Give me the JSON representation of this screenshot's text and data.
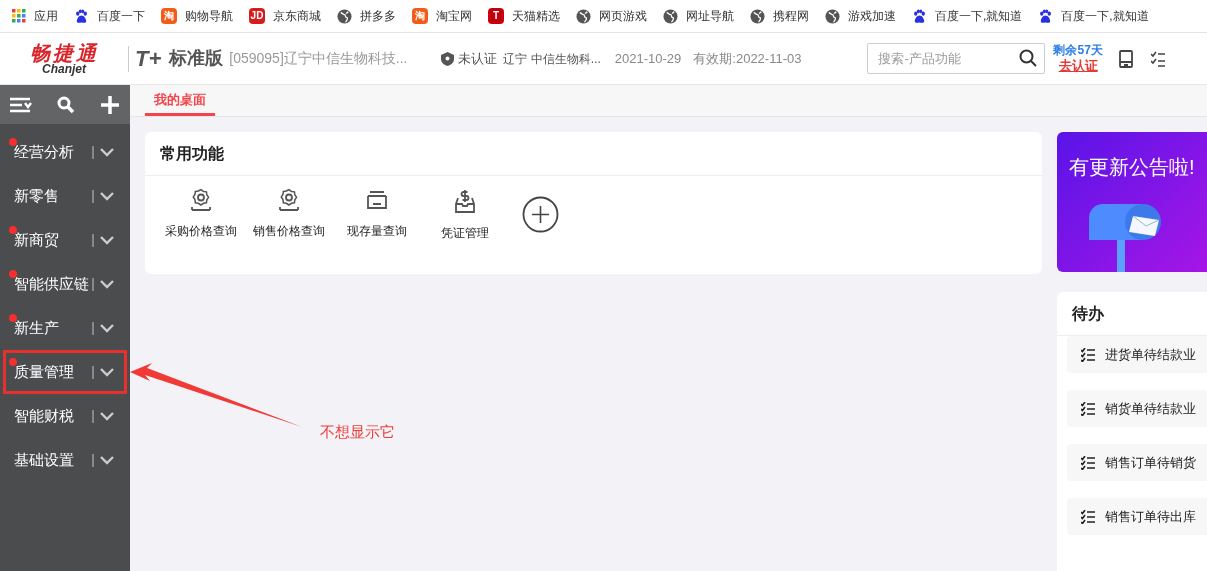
{
  "bookmarks": [
    {
      "kind": "grid",
      "label": "应用"
    },
    {
      "kind": "paw",
      "label": "百度一下"
    },
    {
      "kind": "letter",
      "icon_text": "淘",
      "color": "#f25c19",
      "label": "购物导航"
    },
    {
      "kind": "letter",
      "icon_text": "JD",
      "color": "#d71c1e",
      "label": "京东商城"
    },
    {
      "kind": "globe",
      "label": "拼多多"
    },
    {
      "kind": "letter",
      "icon_text": "淘",
      "color": "#f25c19",
      "label": "淘宝网"
    },
    {
      "kind": "letter",
      "icon_text": "T",
      "color": "#c4000d",
      "label": "天猫精选"
    },
    {
      "kind": "globe",
      "label": "网页游戏"
    },
    {
      "kind": "globe",
      "label": "网址导航"
    },
    {
      "kind": "globe",
      "label": "携程网"
    },
    {
      "kind": "globe",
      "label": "游戏加速"
    },
    {
      "kind": "paw",
      "label": "百度一下,就知道"
    },
    {
      "kind": "paw",
      "label": "百度一下,就知道"
    }
  ],
  "header": {
    "logo_cn": "畅捷通",
    "logo_en": "Chanjet",
    "product": "T+",
    "edition": "标准版",
    "company": "[059095]辽宁中信生物科技...",
    "auth_status": "未认证",
    "auth_company": "辽宁 中信生物科...",
    "date": "2021-10-29",
    "expiry": "有效期:2022-11-03",
    "search": {
      "placeholder": "搜索-产品功能"
    },
    "remaining": "剩余57天",
    "auth_link": "去认证"
  },
  "sidebar": {
    "items": [
      {
        "label": "经营分析",
        "dot": true,
        "annotated": false
      },
      {
        "label": "新零售",
        "dot": false,
        "annotated": false
      },
      {
        "label": "新商贸",
        "dot": true,
        "annotated": false
      },
      {
        "label": "智能供应链",
        "dot": true,
        "annotated": false
      },
      {
        "label": "新生产",
        "dot": true,
        "annotated": false
      },
      {
        "label": "质量管理",
        "dot": true,
        "annotated": true
      },
      {
        "label": "智能财税",
        "dot": false,
        "annotated": false
      },
      {
        "label": "基础设置",
        "dot": false,
        "annotated": false
      }
    ]
  },
  "tabs": [
    {
      "label": "我的桌面",
      "selected": true
    }
  ],
  "common": {
    "title": "常用功能",
    "items": [
      {
        "kind": "gear",
        "label": "采购价格查询"
      },
      {
        "kind": "gear",
        "label": "销售价格查询"
      },
      {
        "kind": "stock",
        "label": "现存量查询"
      },
      {
        "kind": "voucher",
        "label": "凭证管理"
      }
    ]
  },
  "banner": {
    "title": "有更新公告啦!"
  },
  "todo": {
    "title": "待办",
    "items": [
      "进货单待结款业",
      "销货单待结款业",
      "销售订单待销货",
      "销售订单待出库"
    ]
  },
  "annotation": {
    "text": "不想显示它"
  }
}
